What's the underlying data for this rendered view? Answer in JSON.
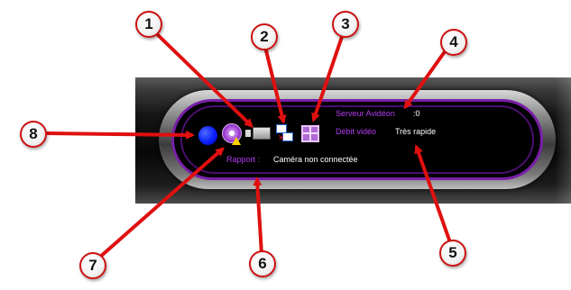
{
  "panel": {
    "server_label": "Serveur Avidéon",
    "server_value": ":0",
    "bitrate_label": "Débit vidéo",
    "bitrate_value": "Très rapide",
    "report_label": "Rapport :",
    "report_value": "Caméra non connectée"
  },
  "icons": {
    "status": "blue-circle-icon",
    "settings": "settings-warning-icon",
    "camera": "camera-icon",
    "screens": "dual-screen-icon",
    "grid": "grid-layout-icon"
  },
  "callouts": [
    "1",
    "2",
    "3",
    "4",
    "5",
    "6",
    "7",
    "8"
  ],
  "colors": {
    "accent": "#b43cf0",
    "ring": "#7a1fa8",
    "arrow": "#e01010",
    "status_dot": "#0a1fff"
  }
}
